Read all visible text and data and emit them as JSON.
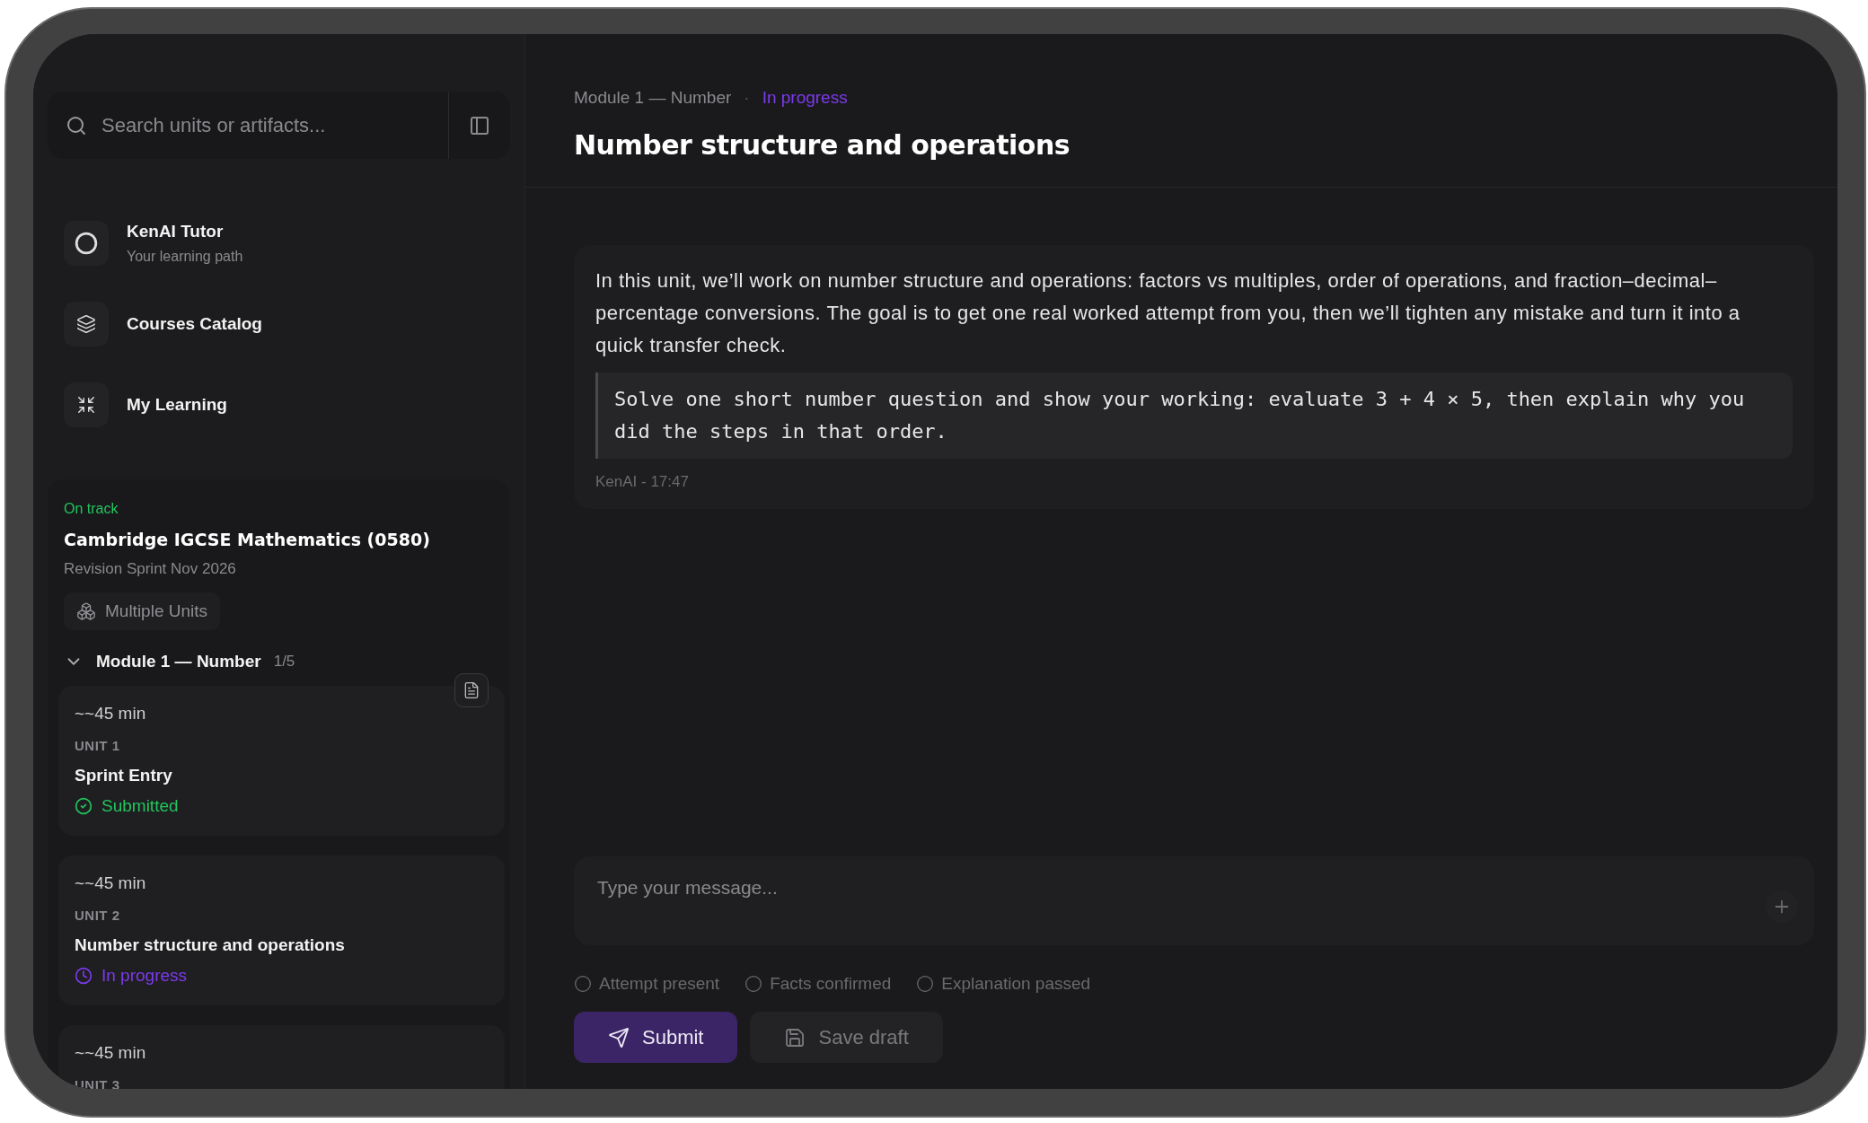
{
  "sidebar": {
    "search": {
      "placeholder": "Search units or artifacts..."
    },
    "nav": [
      {
        "kind": "tutor",
        "label": "KenAI Tutor",
        "sublabel": "Your learning path"
      },
      {
        "kind": "catalog",
        "label": "Courses Catalog"
      },
      {
        "kind": "learning",
        "label": "My Learning"
      }
    ],
    "course": {
      "status": "On track",
      "title": "Cambridge IGCSE Mathematics (0580)",
      "subtitle": "Revision Sprint Nov 2026",
      "chip": "Multiple Units"
    },
    "module": {
      "title": "Module 1 — Number",
      "count": "1/5",
      "expanded": true
    },
    "units": [
      {
        "duration": "~~45 min",
        "unit": "UNIT 1",
        "title": "Sprint Entry",
        "status": {
          "kind": "submitted",
          "label": "Submitted"
        }
      },
      {
        "duration": "~~45 min",
        "unit": "UNIT 2",
        "title": "Number structure and operations",
        "status": {
          "kind": "in_progress",
          "label": "In progress"
        }
      },
      {
        "duration": "~~45 min",
        "unit": "UNIT 3"
      }
    ]
  },
  "main": {
    "breadcrumb": {
      "path": "Module 1 — Number",
      "separator": "·",
      "status": "In progress"
    },
    "title": "Number structure and operations",
    "message": {
      "text": "In this unit, we’ll work on number structure and operations: factors vs multiples, order of operations, and fraction–decimal–percentage conversions. The goal is to get one real worked attempt from you, then we’ll tighten any mistake and turn it into a quick transfer check.",
      "code": "Solve one short number question and show your working: evaluate 3 + 4 × 5, then explain why you did the steps in that order.",
      "meta": "KenAI - 17:47"
    },
    "composer": {
      "placeholder": "Type your message..."
    },
    "checklist": [
      {
        "label": "Attempt present",
        "checked": false
      },
      {
        "label": "Facts confirmed",
        "checked": false
      },
      {
        "label": "Explanation passed",
        "checked": false
      }
    ],
    "buttons": [
      {
        "kind": "submit",
        "label": "Submit"
      },
      {
        "kind": "draft",
        "label": "Save draft"
      }
    ]
  }
}
